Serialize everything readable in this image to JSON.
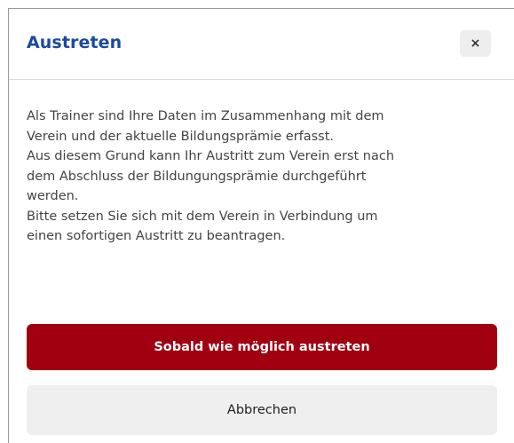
{
  "dialog": {
    "title": "Austreten",
    "close_label": "×",
    "message_lines": [
      "Als Trainer sind Ihre Daten im Zusammenhang mit dem",
      "Verein und der aktuelle Bildungsprämie erfasst.",
      "Aus diesem Grund kann Ihr Austritt zum Verein erst nach",
      "dem Abschluss der Bildungungsprämie durchgeführt",
      "werden.",
      "Bitte setzen Sie sich mit dem Verein in Verbindung um",
      "einen sofortigen Austritt zu beantragen."
    ],
    "primary_button_label": "Sobald wie möglich austreten",
    "secondary_button_label": "Abbrechen"
  },
  "colors": {
    "title": "#1a4a9c",
    "primary_button": "#a00010",
    "secondary_button": "#efefef",
    "text": "#444444"
  }
}
